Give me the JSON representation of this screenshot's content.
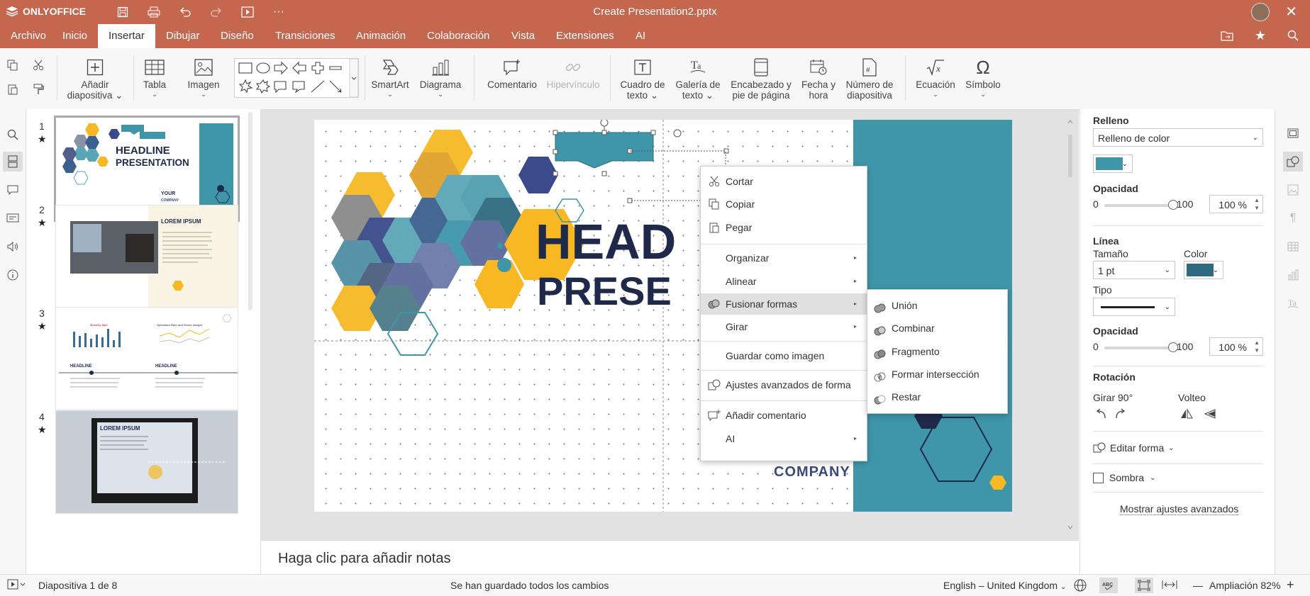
{
  "app": {
    "brand": "ONLYOFFICE",
    "document_title": "Create Presentation2.pptx",
    "accent_color": "#c5664f"
  },
  "menu_tabs": [
    {
      "label": "Archivo"
    },
    {
      "label": "Inicio"
    },
    {
      "label": "Insertar",
      "active": true
    },
    {
      "label": "Dibujar"
    },
    {
      "label": "Diseño"
    },
    {
      "label": "Transiciones"
    },
    {
      "label": "Animación"
    },
    {
      "label": "Colaboración"
    },
    {
      "label": "Vista"
    },
    {
      "label": "Extensiones"
    },
    {
      "label": "AI"
    }
  ],
  "toolbar": {
    "add_slide": [
      "Añadir",
      "diapositiva"
    ],
    "table": "Tabla",
    "image": "Imagen",
    "smartart": "SmartArt",
    "chart": "Diagrama",
    "comment": "Comentario",
    "hyperlink": "Hipervínculo",
    "text_box": [
      "Cuadro de",
      "texto"
    ],
    "text_art": [
      "Galería de",
      "texto"
    ],
    "header_footer": [
      "Encabezado y",
      "pie de página"
    ],
    "date_time": [
      "Fecha y",
      "hora"
    ],
    "slide_number": [
      "Número de",
      "diapositiva"
    ],
    "equation": "Ecuación",
    "symbol": "Símbolo"
  },
  "slides": [
    {
      "number": "1",
      "thumb": {
        "headline1": "HEADLINE",
        "headline2": "PRESENTATION",
        "your": "YOUR",
        "company": "COMPANY"
      }
    },
    {
      "number": "2",
      "thumb": {
        "title": "LOREM IPSUM"
      }
    },
    {
      "number": "3",
      "thumb": {
        "h1": "HEADLINE",
        "h2": "HEADLINE",
        "chart1": "Monthly Sale",
        "chart2": "Operation Rate and Gross margin"
      }
    },
    {
      "number": "4",
      "thumb": {
        "title": "LOREM IPSUM"
      }
    }
  ],
  "slide": {
    "headline1": "HEAD",
    "headline2": "PRESE",
    "company": "COMPANY",
    "teal_color": "#3f96a9",
    "yellow_color": "#f7b823",
    "navy_color": "#1f2a4a"
  },
  "notes_placeholder": "Haga clic para añadir notas",
  "context_menu": {
    "cut": "Cortar",
    "copy": "Copiar",
    "paste": "Pegar",
    "arrange": "Organizar",
    "align": "Alinear",
    "merge_shapes": "Fusionar formas",
    "rotate": "Girar",
    "save_as_image": "Guardar como imagen",
    "shape_advanced": "Ajustes avanzados de forma",
    "add_comment": "Añadir comentario",
    "ai": "AI"
  },
  "merge_submenu": [
    "Unión",
    "Combinar",
    "Fragmento",
    "Formar intersección",
    "Restar"
  ],
  "right_panel": {
    "fill_title": "Relleno",
    "fill_type": "Relleno de color",
    "fill_color": "#3f96a9",
    "opacity_label": "Opacidad",
    "opacity_min": "0",
    "opacity_max": "100",
    "opacity_value": "100 %",
    "line_title": "Línea",
    "size_label": "Tamaño",
    "size_value": "1 pt",
    "color_label": "Color",
    "line_color": "#2e6a80",
    "type_label": "Tipo",
    "line_opacity_label": "Opacidad",
    "line_opacity_min": "0",
    "line_opacity_max": "100",
    "line_opacity_value": "100 %",
    "rotation_title": "Rotación",
    "rotate90": "Girar 90°",
    "flip": "Volteo",
    "edit_shape": "Editar forma",
    "shadow": "Sombra",
    "advanced_link": "Mostrar ajustes avanzados"
  },
  "status_bar": {
    "slide_info": "Diapositiva 1 de 8",
    "save_status": "Se han guardado todos los cambios",
    "language": "English – United Kingdom",
    "zoom": "Ampliación 82%"
  }
}
